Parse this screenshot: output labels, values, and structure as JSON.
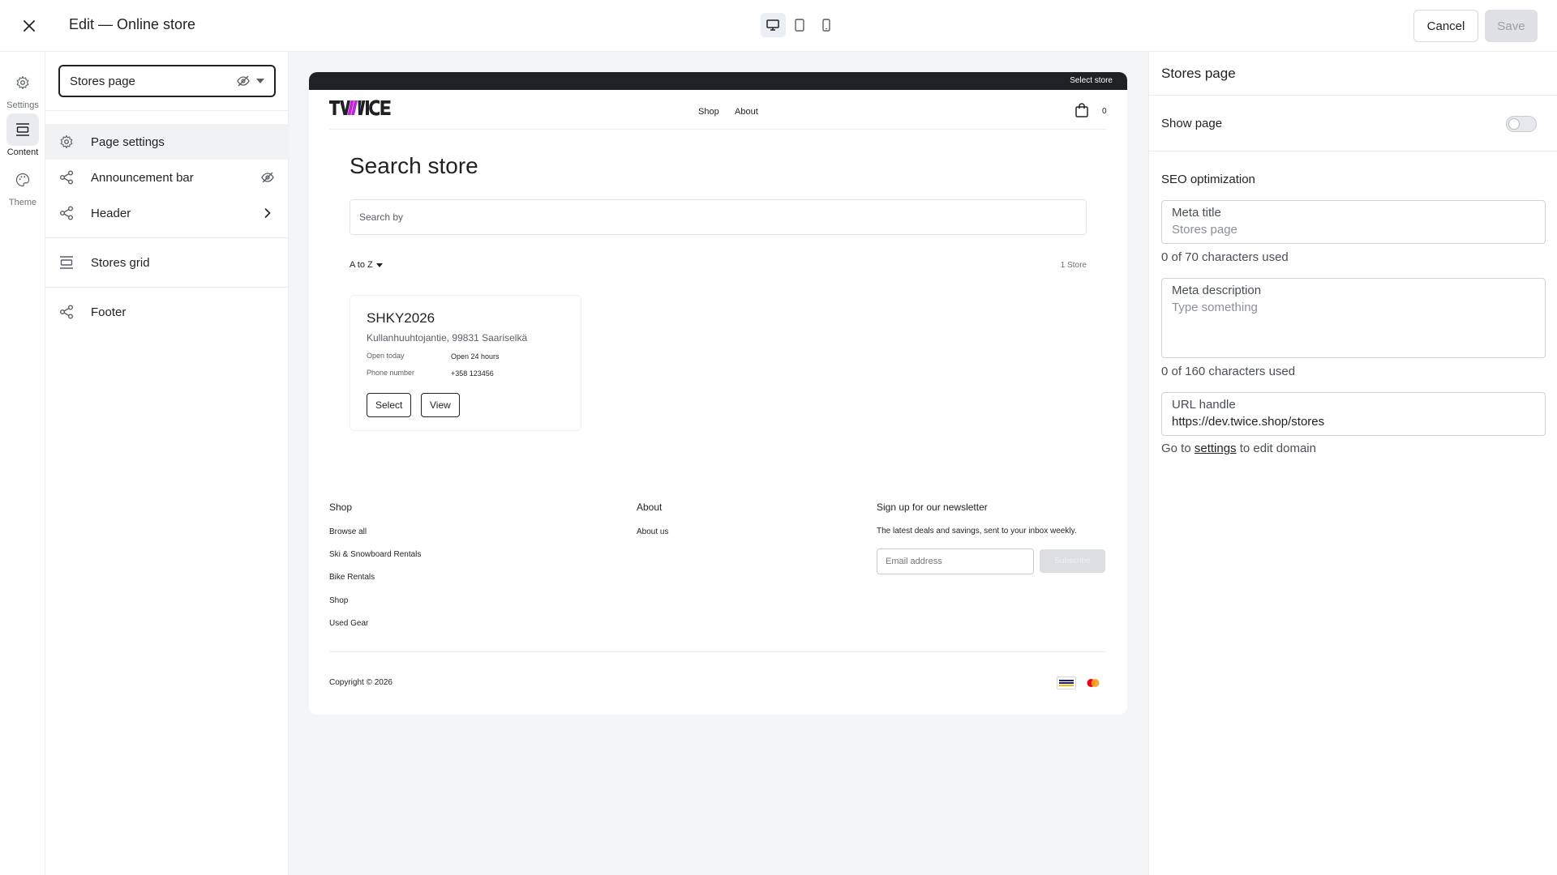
{
  "topbar": {
    "title": "Edit — Online store",
    "cancel_label": "Cancel",
    "save_label": "Save"
  },
  "rail": {
    "items": [
      {
        "label": "Settings",
        "icon": "gear-icon"
      },
      {
        "label": "Content",
        "icon": "sections-icon"
      },
      {
        "label": "Theme",
        "icon": "palette-icon"
      }
    ]
  },
  "sections": {
    "selected_page": "Stores page",
    "items": [
      {
        "label": "Page settings",
        "icon": "gear-icon"
      },
      {
        "label": "Announcement bar",
        "icon": "share-icon"
      },
      {
        "label": "Header",
        "icon": "share-icon"
      },
      {
        "label": "Stores grid",
        "icon": "sections-icon"
      },
      {
        "label": "Footer",
        "icon": "share-icon"
      }
    ]
  },
  "preview": {
    "announcement": "Select store",
    "nav": [
      "Shop",
      "About"
    ],
    "cart_count": "0",
    "page_title": "Search store",
    "search_placeholder": "Search by",
    "sort_label": "A to Z",
    "store_count": "1 Store",
    "store": {
      "name": "SHKY2026",
      "address": "Kullanhuuhtojantie, 99831 Saariselkä",
      "open_label": "Open today",
      "open_value": "Open 24 hours",
      "phone_label": "Phone number",
      "phone_value": "+358 123456",
      "select_label": "Select",
      "view_label": "View"
    },
    "footer": {
      "shop_heading": "Shop",
      "shop_links": [
        "Browse all",
        "Ski & Snowboard Rentals",
        "Bike Rentals",
        "Shop",
        "Used Gear"
      ],
      "about_heading": "About",
      "about_links": [
        "About us"
      ],
      "newsletter_heading": "Sign up for our newsletter",
      "newsletter_text": "The latest deals and savings, sent to your inbox weekly.",
      "email_placeholder": "Email address",
      "subscribe_label": "Subscribe",
      "copyright": "Copyright © 2026"
    }
  },
  "settings": {
    "title": "Stores page",
    "show_page_label": "Show page",
    "show_page_on": false,
    "seo_heading": "SEO optimization",
    "meta_title_label": "Meta title",
    "meta_title_placeholder": "Stores page",
    "meta_title_hint": "0 of 70 characters used",
    "meta_desc_label": "Meta description",
    "meta_desc_placeholder": "Type something",
    "meta_desc_hint": "0 of 160 characters used",
    "url_label": "URL handle",
    "url_value": "https://dev.twice.shop/stores",
    "domain_hint_pre": "Go to",
    "domain_hint_link": "settings",
    "domain_hint_post": "to edit domain"
  },
  "colors": {
    "logo_accent": "#c026d3",
    "dark": "#1f2124",
    "canvas_bg": "#f4f5f7"
  }
}
